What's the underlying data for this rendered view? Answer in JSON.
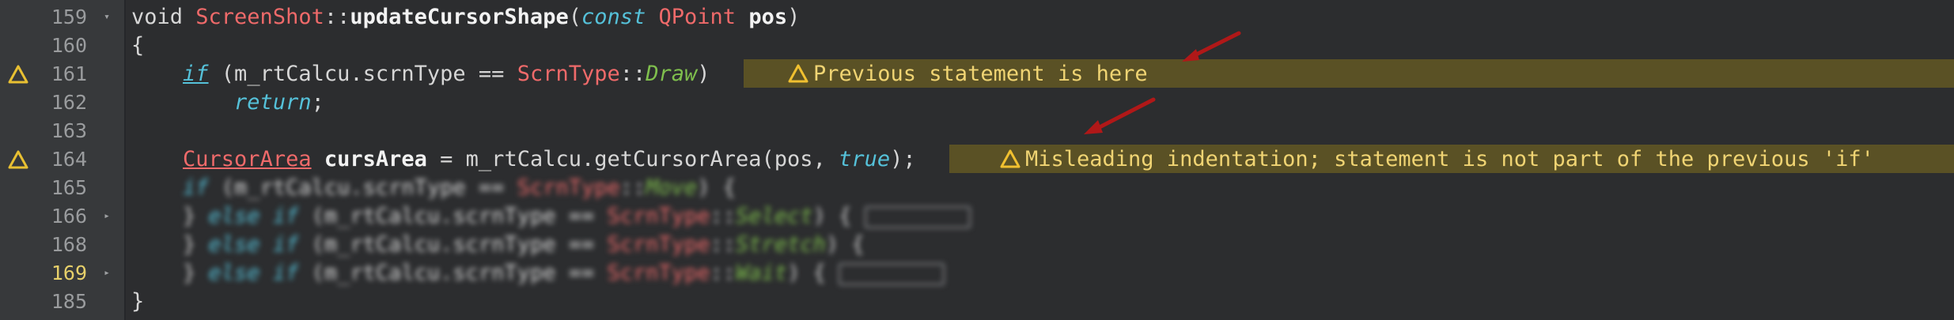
{
  "editor": {
    "lines": [
      {
        "num": "159",
        "fold": "▾"
      },
      {
        "num": "160"
      },
      {
        "num": "161"
      },
      {
        "num": "162"
      },
      {
        "num": "163"
      },
      {
        "num": "164"
      },
      {
        "num": "165"
      },
      {
        "num": "166",
        "fold": "▸"
      },
      {
        "num": "168"
      },
      {
        "num": "169",
        "fold": "▸"
      },
      {
        "num": "185"
      }
    ],
    "code": {
      "l159": {
        "t1": "void ",
        "t2": "ScreenShot",
        "t3": "::",
        "t4": "updateCursorShape",
        "t5": "(",
        "t6": "const",
        "t7": " ",
        "t8": "QPoint",
        "t9": " ",
        "t10": "pos",
        "t11": ")"
      },
      "l160": {
        "t1": "{"
      },
      "l161": {
        "t1": "if",
        "t2": " (m_rtCalcu.scrnType == ",
        "t3": "ScrnType",
        "t4": "::",
        "t5": "Draw",
        "t6": ")"
      },
      "l162": {
        "t1": "return",
        "t2": ";"
      },
      "l164": {
        "t1": "CursorArea",
        "t2": " ",
        "t3": "cursArea",
        "t4": " = m_rtCalcu.getCursorArea(pos, ",
        "t5": "true",
        "t6": ");"
      },
      "l165": {
        "t1": "if",
        "t2": " (m_rtCalcu.scrnType == ",
        "t3": "ScrnType",
        "t4": "::",
        "t5": "Move",
        "t6": ") {"
      },
      "l166": {
        "t1": "} ",
        "t2": "else if",
        "t3": " (m_rtCalcu.scrnType == ",
        "t4": "ScrnType",
        "t5": "::",
        "t6": "Select",
        "t7": ") { "
      },
      "l168": {
        "t1": "} ",
        "t2": "else if",
        "t3": " (m_rtCalcu.scrnType == ",
        "t4": "ScrnType",
        "t5": "::",
        "t6": "Stretch",
        "t7": ") {"
      },
      "l169": {
        "t1": "} ",
        "t2": "else if",
        "t3": " (m_rtCalcu.scrnType == ",
        "t4": "ScrnType",
        "t5": "::",
        "t6": "Wait",
        "t7": ") { "
      },
      "l185": {
        "t1": "}"
      }
    },
    "warnings": {
      "w161": "Previous statement is here",
      "w164": "Misleading indentation; statement is not part of the previous 'if'"
    },
    "colors": {
      "warning_bar": "#5a5125",
      "warning_text": "#f0d473",
      "arrow": "#b01818"
    }
  }
}
